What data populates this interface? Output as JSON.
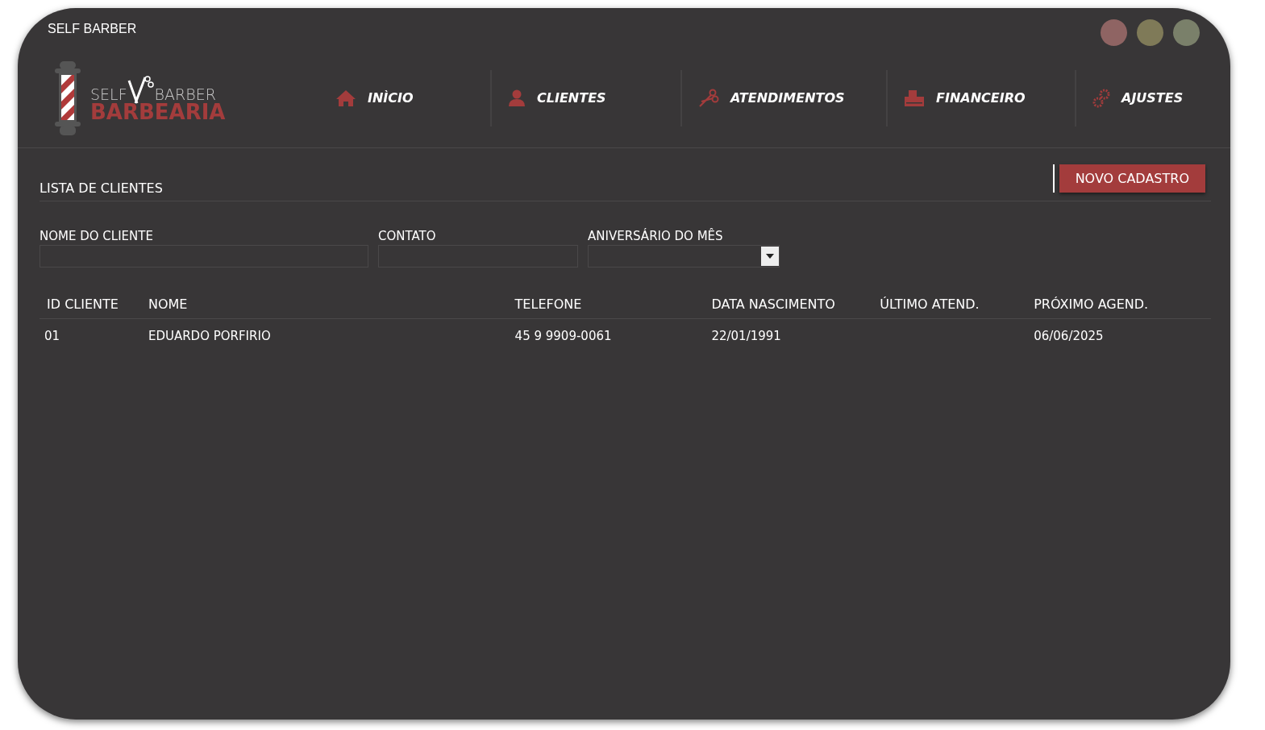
{
  "window": {
    "title": "SELF BARBER"
  },
  "logo": {
    "top_left": "SELF",
    "top_right": "BARBER",
    "bottom": "BARBEARIA"
  },
  "nav": [
    {
      "label": "INÌCIO",
      "kind": "home"
    },
    {
      "label": "CLIENTES",
      "kind": "person"
    },
    {
      "label": "ATENDIMENTOS",
      "kind": "scissors"
    },
    {
      "label": "FINANCEIRO",
      "kind": "register"
    },
    {
      "label": "AJUSTES",
      "kind": "gears"
    }
  ],
  "section_title": "LISTA DE CLIENTES",
  "new_button": "NOVO CADASTRO",
  "filters": [
    {
      "label": "NOME DO CLIENTE",
      "kind": "text"
    },
    {
      "label": "CONTATO",
      "kind": "text"
    },
    {
      "label": "ANIVERSÁRIO DO MÊS",
      "kind": "select"
    }
  ],
  "table": {
    "columns": [
      "ID CLIENTE",
      "NOME",
      "TELEFONE",
      "DATA NASCIMENTO",
      "ÚLTIMO ATEND.",
      "PRÓXIMO AGEND."
    ],
    "rows": [
      [
        "01",
        "EDUARDO PORFIRIO",
        "45 9 9909-0061",
        "22/01/1991",
        "",
        "06/06/2025"
      ]
    ]
  }
}
